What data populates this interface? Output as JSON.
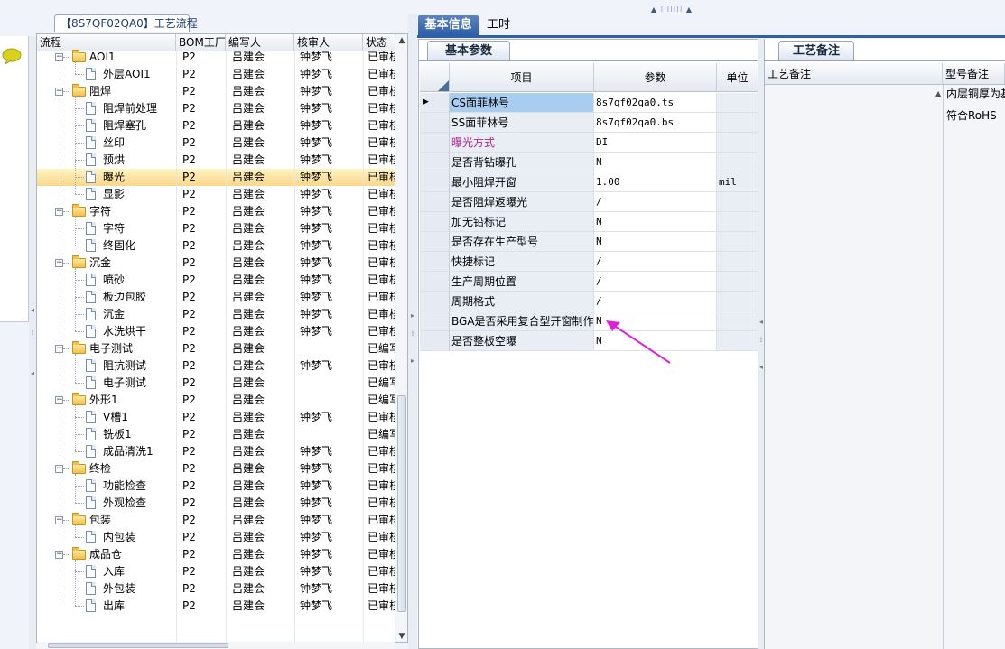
{
  "process_panel": {
    "tab_label": "【8S7QF02QA0】工艺流程",
    "columns": [
      "流程",
      "BOM工厂",
      "编写人",
      "核审人",
      "状态"
    ],
    "rows": [
      {
        "label": "AOI1",
        "kind": "folder",
        "level": 1,
        "expanded": true,
        "bom": "P2",
        "writer": "吕建会",
        "reviewer": "钟梦飞",
        "status": "已审核"
      },
      {
        "label": "外层AOI1",
        "kind": "doc",
        "level": 2,
        "bom": "P2",
        "writer": "吕建会",
        "reviewer": "钟梦飞",
        "status": "已审核"
      },
      {
        "label": "阻焊",
        "kind": "folder",
        "level": 1,
        "expanded": true,
        "bom": "P2",
        "writer": "吕建会",
        "reviewer": "钟梦飞",
        "status": "已审核"
      },
      {
        "label": "阻焊前处理",
        "kind": "doc",
        "level": 2,
        "bom": "P2",
        "writer": "吕建会",
        "reviewer": "钟梦飞",
        "status": "已审核"
      },
      {
        "label": "阻焊塞孔",
        "kind": "doc",
        "level": 2,
        "bom": "P2",
        "writer": "吕建会",
        "reviewer": "钟梦飞",
        "status": "已审核"
      },
      {
        "label": "丝印",
        "kind": "doc",
        "level": 2,
        "bom": "P2",
        "writer": "吕建会",
        "reviewer": "钟梦飞",
        "status": "已审核"
      },
      {
        "label": "预烘",
        "kind": "doc",
        "level": 2,
        "bom": "P2",
        "writer": "吕建会",
        "reviewer": "钟梦飞",
        "status": "已审核"
      },
      {
        "label": "曝光",
        "kind": "doc",
        "level": 2,
        "selected": true,
        "bom": "P2",
        "writer": "吕建会",
        "reviewer": "钟梦飞",
        "status": "已审核"
      },
      {
        "label": "显影",
        "kind": "doc",
        "level": 2,
        "bom": "P2",
        "writer": "吕建会",
        "reviewer": "钟梦飞",
        "status": "已审核"
      },
      {
        "label": "字符",
        "kind": "folder",
        "level": 1,
        "expanded": true,
        "bom": "P2",
        "writer": "吕建会",
        "reviewer": "钟梦飞",
        "status": "已审核"
      },
      {
        "label": "字符",
        "kind": "doc",
        "level": 2,
        "bom": "P2",
        "writer": "吕建会",
        "reviewer": "钟梦飞",
        "status": "已审核"
      },
      {
        "label": "终固化",
        "kind": "doc",
        "level": 2,
        "bom": "P2",
        "writer": "吕建会",
        "reviewer": "钟梦飞",
        "status": "已审核"
      },
      {
        "label": "沉金",
        "kind": "folder",
        "level": 1,
        "expanded": true,
        "bom": "P2",
        "writer": "吕建会",
        "reviewer": "钟梦飞",
        "status": "已审核"
      },
      {
        "label": "喷砂",
        "kind": "doc",
        "level": 2,
        "bom": "P2",
        "writer": "吕建会",
        "reviewer": "钟梦飞",
        "status": "已审核"
      },
      {
        "label": "板边包胶",
        "kind": "doc",
        "level": 2,
        "bom": "P2",
        "writer": "吕建会",
        "reviewer": "钟梦飞",
        "status": "已审核"
      },
      {
        "label": "沉金",
        "kind": "doc",
        "level": 2,
        "bom": "P2",
        "writer": "吕建会",
        "reviewer": "钟梦飞",
        "status": "已审核"
      },
      {
        "label": "水洗烘干",
        "kind": "doc",
        "level": 2,
        "bom": "P2",
        "writer": "吕建会",
        "reviewer": "钟梦飞",
        "status": "已审核"
      },
      {
        "label": "电子测试",
        "kind": "folder",
        "level": 1,
        "expanded": true,
        "bom": "P2",
        "writer": "吕建会",
        "reviewer": "",
        "status": "已编写"
      },
      {
        "label": "阻抗测试",
        "kind": "doc",
        "level": 2,
        "bom": "P2",
        "writer": "吕建会",
        "reviewer": "钟梦飞",
        "status": "已审核"
      },
      {
        "label": "电子测试",
        "kind": "doc",
        "level": 2,
        "bom": "P2",
        "writer": "吕建会",
        "reviewer": "",
        "status": "已编写"
      },
      {
        "label": "外形1",
        "kind": "folder",
        "level": 1,
        "expanded": true,
        "bom": "P2",
        "writer": "吕建会",
        "reviewer": "",
        "status": "已编写"
      },
      {
        "label": "V槽1",
        "kind": "doc",
        "level": 2,
        "bom": "P2",
        "writer": "吕建会",
        "reviewer": "钟梦飞",
        "status": "已审核"
      },
      {
        "label": "铣板1",
        "kind": "doc",
        "level": 2,
        "bom": "P2",
        "writer": "吕建会",
        "reviewer": "",
        "status": "已编写"
      },
      {
        "label": "成品清洗1",
        "kind": "doc",
        "level": 2,
        "bom": "P2",
        "writer": "吕建会",
        "reviewer": "钟梦飞",
        "status": "已审核"
      },
      {
        "label": "终检",
        "kind": "folder",
        "level": 1,
        "expanded": true,
        "bom": "P2",
        "writer": "吕建会",
        "reviewer": "钟梦飞",
        "status": "已审核"
      },
      {
        "label": "功能检查",
        "kind": "doc",
        "level": 2,
        "bom": "P2",
        "writer": "吕建会",
        "reviewer": "钟梦飞",
        "status": "已审核"
      },
      {
        "label": "外观检查",
        "kind": "doc",
        "level": 2,
        "bom": "P2",
        "writer": "吕建会",
        "reviewer": "钟梦飞",
        "status": "已审核"
      },
      {
        "label": "包装",
        "kind": "folder",
        "level": 1,
        "expanded": true,
        "bom": "P2",
        "writer": "吕建会",
        "reviewer": "钟梦飞",
        "status": "已审核"
      },
      {
        "label": "内包装",
        "kind": "doc",
        "level": 2,
        "bom": "P2",
        "writer": "吕建会",
        "reviewer": "钟梦飞",
        "status": "已审核"
      },
      {
        "label": "成品仓",
        "kind": "folder",
        "level": 1,
        "expanded": true,
        "bom": "P2",
        "writer": "吕建会",
        "reviewer": "钟梦飞",
        "status": "已审核"
      },
      {
        "label": "入库",
        "kind": "doc",
        "level": 2,
        "bom": "P2",
        "writer": "吕建会",
        "reviewer": "钟梦飞",
        "status": "已审核"
      },
      {
        "label": "外包装",
        "kind": "doc",
        "level": 2,
        "bom": "P2",
        "writer": "吕建会",
        "reviewer": "钟梦飞",
        "status": "已审核"
      },
      {
        "label": "出库",
        "kind": "doc",
        "level": 2,
        "bom": "P2",
        "writer": "吕建会",
        "reviewer": "钟梦飞",
        "status": "已审核"
      }
    ]
  },
  "main_tabs": [
    {
      "label": "基本信息",
      "active": true
    },
    {
      "label": "工时",
      "active": false
    }
  ],
  "basic_params": {
    "tab_label": "基本参数",
    "columns": [
      "项目",
      "参数",
      "单位"
    ],
    "rows": [
      {
        "item": "CS面菲林号",
        "value": "8s7qf02qa0.ts",
        "unit": "",
        "current": true
      },
      {
        "item": "SS面菲林号",
        "value": "8s7qf02qa0.bs",
        "unit": ""
      },
      {
        "item": "曝光方式",
        "value": "DI",
        "unit": "",
        "highlight": true
      },
      {
        "item": "是否背钻曝孔",
        "value": "N",
        "unit": ""
      },
      {
        "item": "最小阻焊开窗",
        "value": "1.00",
        "unit": "mil"
      },
      {
        "item": "是否阻焊返曝光",
        "value": "/",
        "unit": ""
      },
      {
        "item": "加无铅标记",
        "value": "N",
        "unit": ""
      },
      {
        "item": "是否存在生产型号",
        "value": "N",
        "unit": ""
      },
      {
        "item": "快捷标记",
        "value": "/",
        "unit": ""
      },
      {
        "item": "生产周期位置",
        "value": "/",
        "unit": ""
      },
      {
        "item": "周期格式",
        "value": "/",
        "unit": ""
      },
      {
        "item": "BGA是否采用复合型开窗制作",
        "value": "N",
        "unit": ""
      },
      {
        "item": "是否整板空曝",
        "value": "N",
        "unit": ""
      }
    ]
  },
  "remarks": {
    "tab_label": "工艺备注",
    "col1_header": "工艺备注",
    "col2_header": "型号备注",
    "col2_lines": [
      "内层铜厚为基",
      "符合RoHS"
    ]
  },
  "colors": {
    "accent": "#2f5fa6",
    "highlight_text": "#b0268e",
    "annotation_arrow": "#e020d8",
    "selection": "#fbd889"
  }
}
